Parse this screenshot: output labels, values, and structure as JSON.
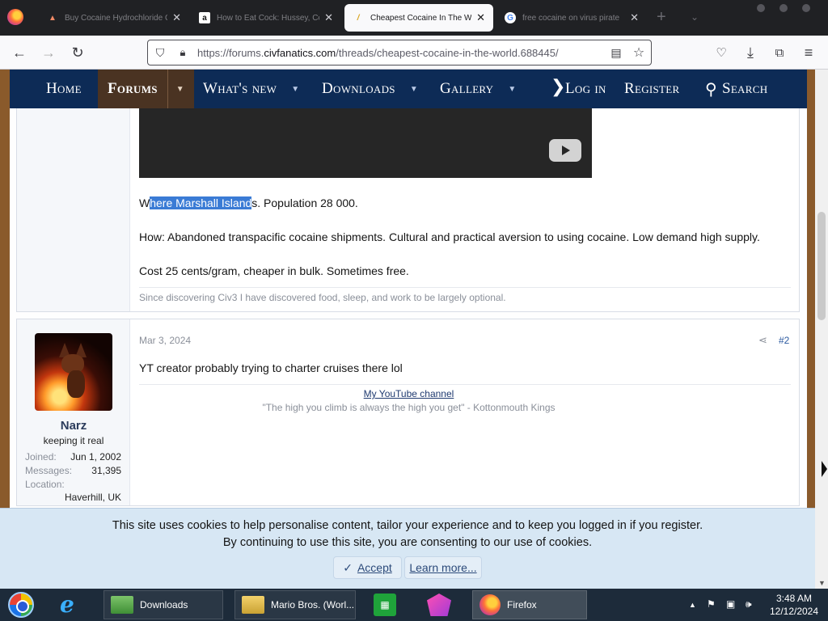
{
  "browser": {
    "tabs": [
      {
        "label": "Buy Cocaine Hydrochloride C",
        "icon": "warning-favicon-icon",
        "active": false
      },
      {
        "label": "How to Eat Cock: Hussey, Co",
        "icon": "amazon-favicon-icon",
        "active": false
      },
      {
        "label": "Cheapest Cocaine In The Wor",
        "icon": "civfanatics-favicon-icon",
        "active": true
      },
      {
        "label": "free cocaine on virus pirate",
        "icon": "google-favicon-icon",
        "active": false
      }
    ],
    "url_prefix": "https://forums.",
    "url_domain": "civfanatics.com",
    "url_path": "/threads/cheapest-cocaine-in-the-world.688445/",
    "tab_close_glyph": "✕",
    "new_tab_glyph": "+"
  },
  "nav": {
    "home": "Home",
    "forums": "Forums",
    "whats_new": "What's new",
    "downloads": "Downloads",
    "gallery": "Gallery",
    "login": "Log in",
    "register": "Register",
    "search": "Search"
  },
  "post1": {
    "line1_pre": "W",
    "line1_highlight": "here Marshall Island",
    "line1_post": "s. Population 28 000.",
    "line2": "How: Abandoned transpacific cocaine shipments. Cultural and practical aversion to using cocaine. Low demand high supply.",
    "line3": "Cost 25 cents/gram, cheaper in bulk. Sometimes free.",
    "signature": "Since discovering Civ3 I have discovered food, sleep, and work to be largely optional."
  },
  "post2": {
    "username": "Narz",
    "user_title": "keeping it real",
    "stats": [
      {
        "key": "Joined:",
        "value": "Jun 1, 2002"
      },
      {
        "key": "Messages:",
        "value": "31,395"
      },
      {
        "key": "Location:",
        "value": "Haverhill, UK"
      }
    ],
    "date": "Mar 3, 2024",
    "number": "#2",
    "text": "YT creator probably trying to charter cruises there lol",
    "sig_link": "My YouTube channel",
    "sig_quote": "\"The high you climb is always the high you get\" - Kottonmouth Kings"
  },
  "cookie": {
    "line1": "This site uses cookies to help personalise content, tailor your experience and to keep you logged in if you register.",
    "line2": "By continuing to use this site, you are consenting to our use of cookies.",
    "accept": "Accept",
    "learn_more": "Learn more..."
  },
  "taskbar": {
    "tasks": [
      "Downloads",
      "Mario Bros. (Worl...",
      "Firefox"
    ],
    "time": "3:48 AM",
    "date": "12/12/2024"
  }
}
